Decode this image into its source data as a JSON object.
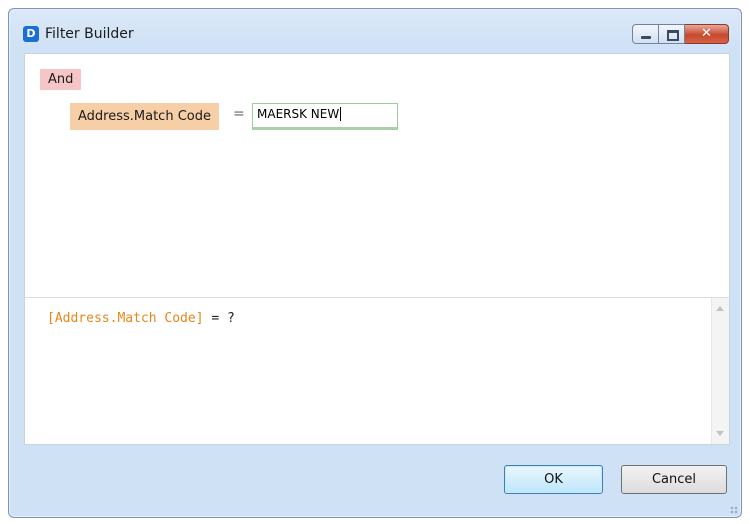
{
  "window": {
    "icon_letter": "D",
    "title": "Filter Builder",
    "controls": {
      "minimize_icon": "minimize-icon",
      "maximize_icon": "maximize-icon",
      "close_glyph": "✕"
    }
  },
  "builder": {
    "group_operator": "And",
    "condition": {
      "field": "Address.Match Code",
      "operator": "=",
      "value": "MAERSK NEW"
    }
  },
  "expression": {
    "field": "[Address.Match Code]",
    "rest": " = ?"
  },
  "buttons": {
    "ok": "OK",
    "cancel": "Cancel"
  },
  "colors": {
    "group_bg": "#f6c5c6",
    "field_bg": "#f7cfa6",
    "value_underline": "#a8cfa8",
    "expr_field": "#e8861a"
  }
}
